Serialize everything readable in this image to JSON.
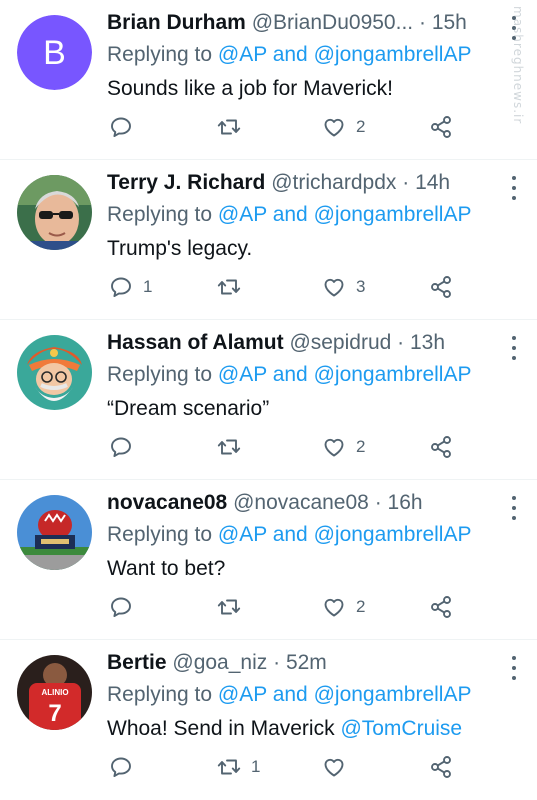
{
  "icons": {
    "reply": "reply-icon",
    "retweet": "retweet-icon",
    "like": "like-icon",
    "share": "share-icon",
    "more": "more-icon"
  },
  "colors": {
    "link": "#1d9bf0",
    "secondary_text": "#536471",
    "primary_text": "#0f1419",
    "divider": "#eff3f4"
  },
  "watermark": {
    "text": "mashreghnews.ir"
  },
  "tweets": [
    {
      "avatar_letter": "B",
      "name": "Brian Durham",
      "handle": "@BrianDu0950...",
      "sep": "·",
      "time": "15h",
      "reply_prefix": "Replying to",
      "reply_user1": "@AP",
      "reply_and": "and",
      "reply_user2": "@jongambrellAP",
      "text": "Sounds like a job for Maverick!",
      "text_link": "",
      "replies": "",
      "retweets": "",
      "likes": "2"
    },
    {
      "avatar_letter": "",
      "name": "Terry J. Richard",
      "handle": "@trichardpdx",
      "sep": "·",
      "time": "14h",
      "reply_prefix": "Replying to",
      "reply_user1": "@AP",
      "reply_and": "and",
      "reply_user2": "@jongambrellAP",
      "text": "Trump's legacy.",
      "text_link": "",
      "replies": "1",
      "retweets": "",
      "likes": "3"
    },
    {
      "avatar_letter": "",
      "name": "Hassan of Alamut",
      "handle": "@sepidrud",
      "sep": "·",
      "time": "13h",
      "reply_prefix": "Replying to",
      "reply_user1": "@AP",
      "reply_and": "and",
      "reply_user2": "@jongambrellAP",
      "text": "“Dream scenario”",
      "text_link": "",
      "replies": "",
      "retweets": "",
      "likes": "2"
    },
    {
      "avatar_letter": "",
      "name": "novacane08",
      "handle": "@novacane08",
      "sep": "·",
      "time": "16h",
      "reply_prefix": "Replying to",
      "reply_user1": "@AP",
      "reply_and": "and",
      "reply_user2": "@jongambrellAP",
      "text": "Want to bet?",
      "text_link": "",
      "replies": "",
      "retweets": "",
      "likes": "2"
    },
    {
      "avatar_letter": "",
      "avatar_jersey_name": "ALINIO",
      "avatar_jersey_number": "7",
      "name": "Bertie",
      "handle": "@goa_niz",
      "sep": "·",
      "time": "52m",
      "reply_prefix": "Replying to",
      "reply_user1": "@AP",
      "reply_and": "and",
      "reply_user2": "@jongambrellAP",
      "text": "Whoa! Send in Maverick ",
      "text_link": "@TomCruise",
      "replies": "",
      "retweets": "1",
      "likes": ""
    }
  ]
}
